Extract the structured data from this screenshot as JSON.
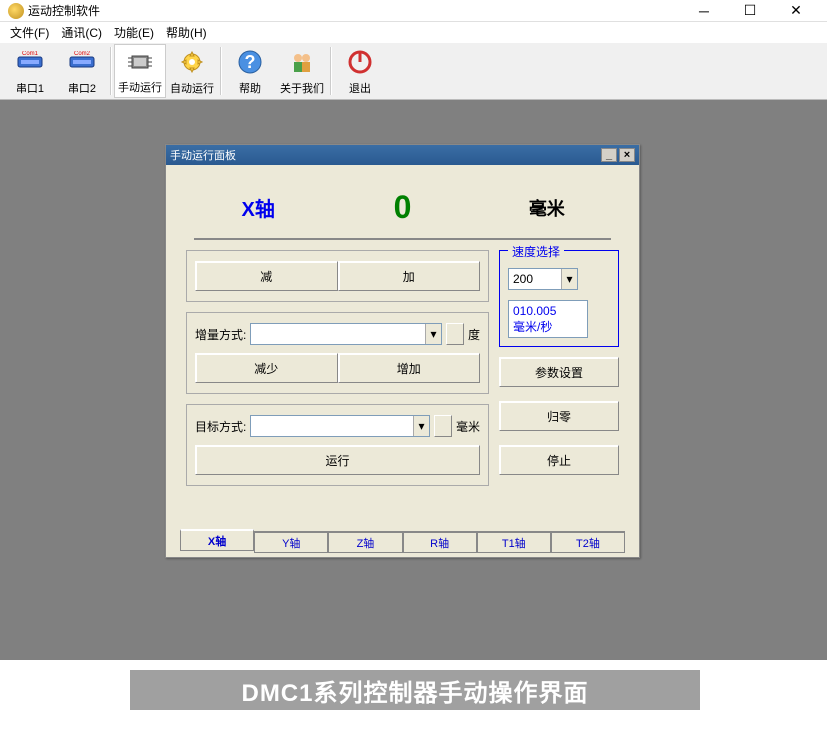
{
  "window": {
    "title": "运动控制软件"
  },
  "menubar": {
    "items": [
      "文件(F)",
      "通讯(C)",
      "功能(E)",
      "帮助(H)"
    ]
  },
  "toolbar": {
    "com1": "串口1",
    "com2": "串口2",
    "manual": "手动运行",
    "auto": "自动运行",
    "help": "帮助",
    "about": "关于我们",
    "exit": "退出"
  },
  "panel": {
    "title": "手动运行面板",
    "axis_label": "X轴",
    "reading": "0",
    "unit": "毫米",
    "btn_minus": "减",
    "btn_plus": "加",
    "increment_label": "增量方式:",
    "increment_value": "",
    "increment_unit": "度",
    "btn_decrease": "减少",
    "btn_increase": "增加",
    "target_label": "目标方式:",
    "target_value": "",
    "target_unit": "毫米",
    "btn_run": "运行",
    "speed_group_title": "速度选择",
    "speed_value": "200",
    "speed_display_num": "010.005",
    "speed_display_unit": "毫米/秒",
    "btn_param": "参数设置",
    "btn_home": "归零",
    "btn_stop": "停止",
    "tabs": [
      "X轴",
      "Y轴",
      "Z轴",
      "R轴",
      "T1轴",
      "T2轴"
    ]
  },
  "caption": "DMC1系列控制器手动操作界面"
}
